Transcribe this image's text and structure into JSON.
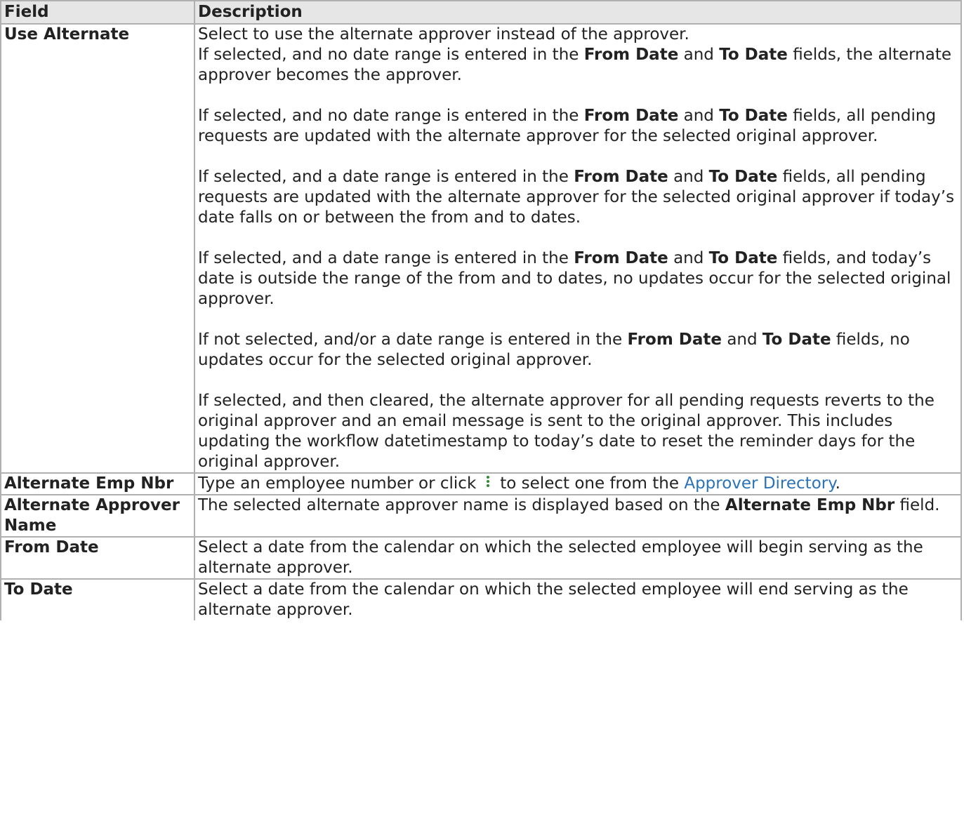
{
  "table": {
    "headers": [
      "Field",
      "Description"
    ],
    "use_alternate": {
      "field": "Use Alternate",
      "p1": {
        "line1": "Select to use the alternate approver instead of the approver.",
        "pre": "If selected, and no date range is entered in the",
        "from_date": "From Date",
        "and": "and",
        "to_date": "To Date",
        "post": "fields, the alternate approver becomes the approver."
      },
      "p2": {
        "pre": "If selected, and no date range is entered in the",
        "from_date": "From Date",
        "and": "and",
        "to_date": "To Date",
        "post": "fields, all pending requests are updated with the alternate approver for the selected original approver."
      },
      "p3": {
        "pre": "If selected, and a date range is entered in the",
        "from_date": "From Date",
        "and": "and",
        "to_date": "To Date",
        "post": "fields, all pending requests are updated with the alternate approver for the selected original approver if today’s date falls on or between the from and to dates."
      },
      "p4": {
        "pre": "If selected, and a date range is entered in the",
        "from_date": "From Date",
        "and": "and",
        "to_date": "To Date",
        "post": "fields, and today’s date is outside the range of the from and to dates, no updates occur for the selected original approver."
      },
      "p5": {
        "pre": "If not selected, and/or a date range is entered in the",
        "from_date": "From Date",
        "and": "and",
        "to_date": "To Date",
        "post": "fields, no updates occur for the selected original approver."
      },
      "p6": "If selected, and then cleared, the alternate approver for all pending requests reverts to the original approver and an email message is sent to the original approver. This includes updating the workflow datetimestamp to today’s date to reset the reminder days for the original approver."
    },
    "alternate_emp_nbr": {
      "field": "Alternate Emp Nbr",
      "pre": "Type an employee number or click",
      "icon": "vertical-dots-icon",
      "mid": "to select one from the",
      "link": "Approver Directory",
      "end": "."
    },
    "alternate_approver_name": {
      "field": "Alternate Approver Name",
      "pre": "The selected alternate approver name is displayed based on the",
      "bold": "Alternate Emp Nbr",
      "post": "field."
    },
    "from_date": {
      "field": "From Date",
      "desc": "Select a date from the calendar on which the selected employee will begin serving as the alternate approver."
    },
    "to_date": {
      "field": "To Date",
      "desc": "Select a date from the calendar on which the selected employee will end serving as the alternate approver."
    }
  },
  "colors": {
    "link": "#2b73b7",
    "header_bg": "#e6e6e6",
    "border": "#b0b0b0",
    "icon": "#2f8a2f"
  }
}
